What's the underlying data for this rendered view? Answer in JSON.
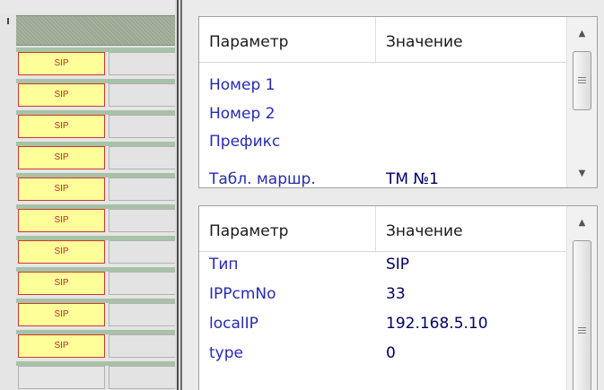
{
  "channels": {
    "items": [
      {
        "label": "SIP"
      },
      {
        "label": "SIP"
      },
      {
        "label": "SIP"
      },
      {
        "label": "SIP"
      },
      {
        "label": "SIP"
      },
      {
        "label": "SIP"
      },
      {
        "label": "SIP"
      },
      {
        "label": "SIP"
      },
      {
        "label": "SIP"
      },
      {
        "label": "SIP"
      }
    ]
  },
  "top_grid": {
    "headers": {
      "param": "Параметр",
      "value": "Значение"
    },
    "rows": [
      {
        "param": "Номер 1",
        "value": ""
      },
      {
        "param": "Номер 2",
        "value": ""
      },
      {
        "param": "Префикс",
        "value": ""
      },
      {
        "param": "Табл. маршр.",
        "value": "ТМ №1"
      }
    ]
  },
  "bottom_grid": {
    "headers": {
      "param": "Параметр",
      "value": "Значение"
    },
    "rows": [
      {
        "param": "Тип",
        "value": "SIP"
      },
      {
        "param": "IPPcmNo",
        "value": "33"
      },
      {
        "param": "localIP",
        "value": "192.168.5.10"
      },
      {
        "param": "type",
        "value": "0"
      }
    ]
  },
  "icons": {
    "scroll_up": "▲",
    "scroll_down": "▼"
  },
  "colors": {
    "sip_fill": "#ffff9a",
    "sip_border": "#cc3a2c",
    "param_text": "#262bb0",
    "value_text": "#000066"
  }
}
